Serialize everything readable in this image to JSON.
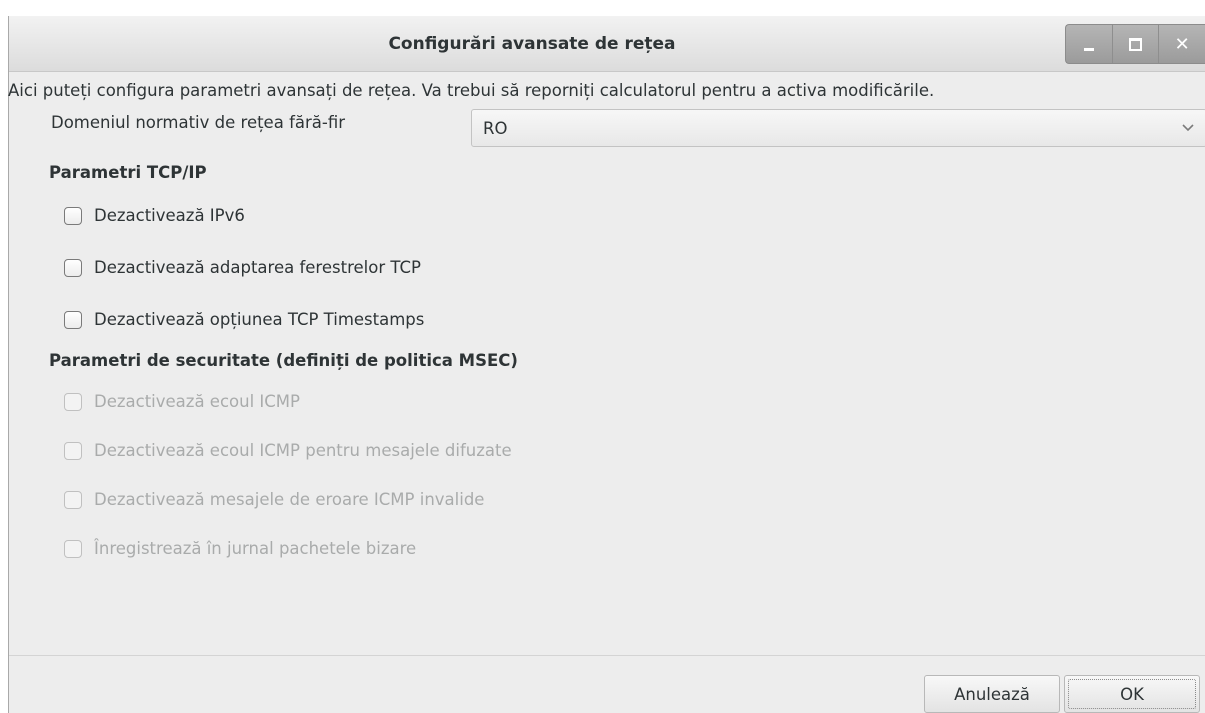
{
  "window": {
    "title": "Configurări avansate de rețea",
    "buttons": {
      "minimize": "minimize-icon",
      "maximize": "maximize-icon",
      "close": "close-icon"
    }
  },
  "intro": "Aici puteți configura parametri avansați de rețea. Va trebui să reporniți calculatorul pentru a activa modificările.",
  "regulatory_domain": {
    "label": "Domeniul normativ de rețea fără-fir",
    "selected": "RO"
  },
  "tcp_section": {
    "title": "Parametri TCP/IP",
    "options": [
      {
        "label": "Dezactivează IPv6",
        "checked": false,
        "enabled": true
      },
      {
        "label": "Dezactivează adaptarea ferestrelor TCP",
        "checked": false,
        "enabled": true
      },
      {
        "label": "Dezactivează opțiunea TCP Timestamps",
        "checked": false,
        "enabled": true
      }
    ]
  },
  "security_section": {
    "title": "Parametri de securitate (definiți de politica MSEC)",
    "options": [
      {
        "label": "Dezactivează ecoul ICMP",
        "checked": false,
        "enabled": false
      },
      {
        "label": "Dezactivează ecoul ICMP pentru mesajele difuzate",
        "checked": false,
        "enabled": false
      },
      {
        "label": "Dezactivează mesajele de eroare ICMP invalide",
        "checked": false,
        "enabled": false
      },
      {
        "label": "Înregistrează în jurnal pachetele bizare",
        "checked": false,
        "enabled": false
      }
    ]
  },
  "footer": {
    "cancel_label": "Anulează",
    "ok_label": "OK"
  }
}
